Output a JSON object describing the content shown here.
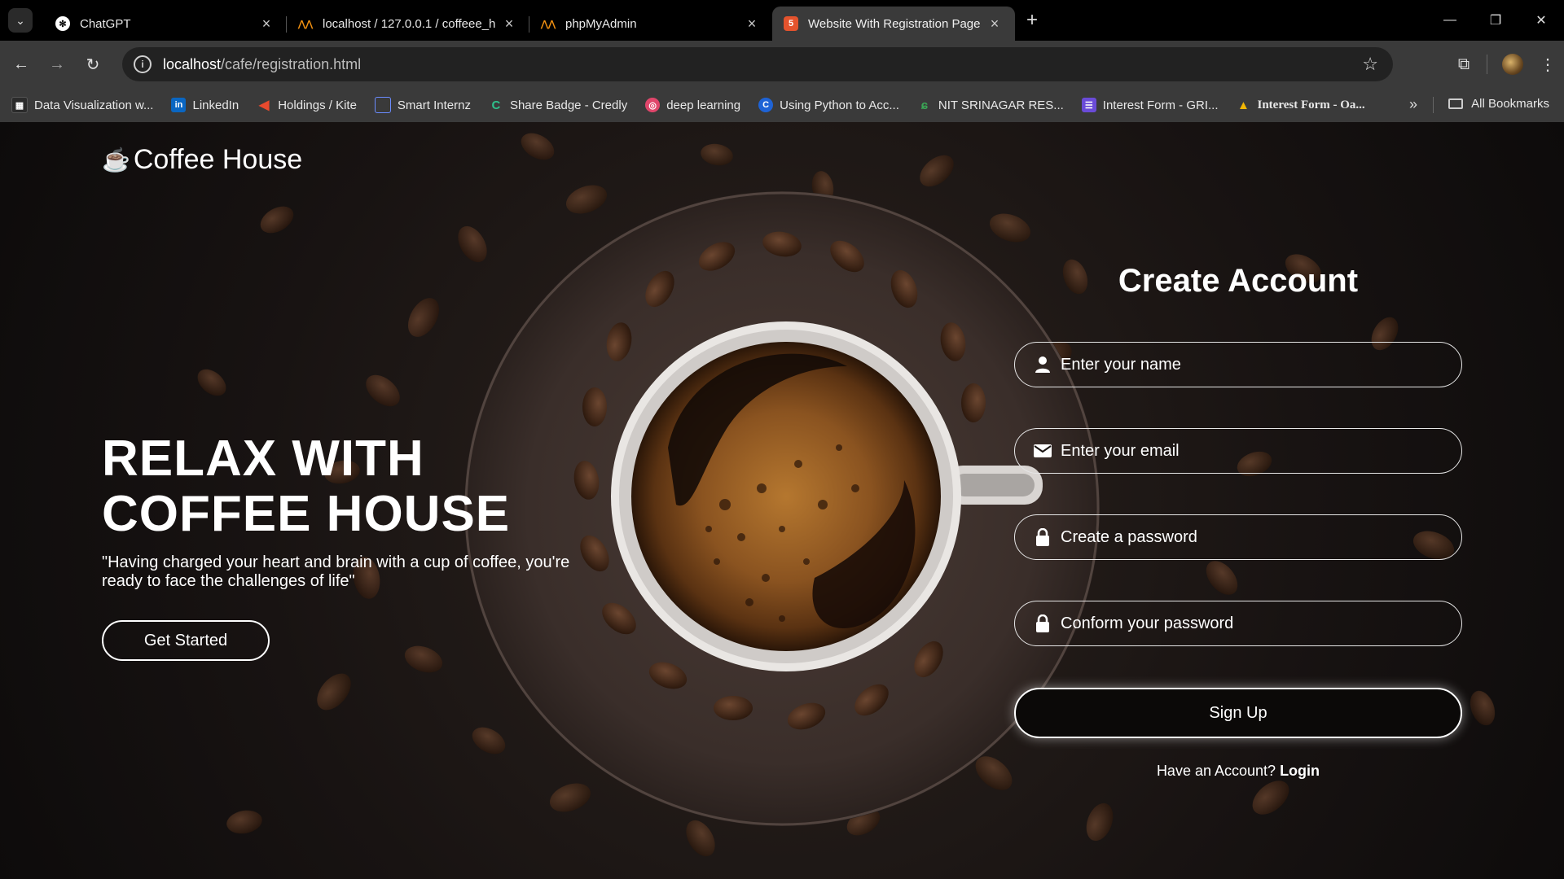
{
  "browser": {
    "tabs": [
      {
        "title": "ChatGPT",
        "icon": "chatgpt-icon"
      },
      {
        "title": "localhost / 127.0.0.1 / coffeee_h",
        "icon": "phpmyadmin-icon"
      },
      {
        "title": "phpMyAdmin",
        "icon": "phpmyadmin-icon"
      },
      {
        "title": "Website With Registration Page",
        "icon": "html5-icon"
      }
    ],
    "url": {
      "host": "localhost",
      "path": "/cafe/registration.html"
    },
    "bookmarks": [
      {
        "label": "Data Visualization w...",
        "icon": "bookmark-icon",
        "color": "#2b2b2b"
      },
      {
        "label": "LinkedIn",
        "icon": "linkedin-icon",
        "color": "#0a66c2"
      },
      {
        "label": "Holdings / Kite",
        "icon": "kite-icon",
        "color": "#e84a2e"
      },
      {
        "label": "Smart Internz",
        "icon": "smartinternz-icon",
        "color": "#3b5bdb"
      },
      {
        "label": "Share Badge - Credly",
        "icon": "credly-icon",
        "color": "#1f8a70"
      },
      {
        "label": "deep learning",
        "icon": "deeplearning-icon",
        "color": "#e0466b"
      },
      {
        "label": "Using Python to Acc...",
        "icon": "coursera-icon",
        "color": "#1e63d6"
      },
      {
        "label": "NIT SRINAGAR RES...",
        "icon": "nit-icon",
        "color": "#3aa655"
      },
      {
        "label": "Interest Form - GRI...",
        "icon": "form-icon",
        "color": "#6a4bd8"
      },
      {
        "label": "Interest Form - Oa...",
        "icon": "drive-icon",
        "color": "#f2b705"
      }
    ],
    "all_bookmarks": "All Bookmarks"
  },
  "site": {
    "logo": "Coffee House",
    "hero_line1": "RELAX WITH",
    "hero_line2": "COFFEE HOUSE",
    "quote": "\"Having charged your heart and brain with a cup of coffee, you're ready to face the challenges of life\"",
    "cta": "Get Started"
  },
  "form": {
    "title": "Create Account",
    "name_placeholder": "Enter your name",
    "email_placeholder": "Enter your email",
    "password_placeholder": "Create a password",
    "confirm_placeholder": "Conform your password",
    "submit": "Sign Up",
    "have_account": "Have an Account?",
    "login": "Login"
  },
  "colors": {
    "chrome_bg": "#000000",
    "toolbar_bg": "#3a3a3a",
    "page_bg": "#1e1b1a",
    "text": "#ffffff"
  }
}
